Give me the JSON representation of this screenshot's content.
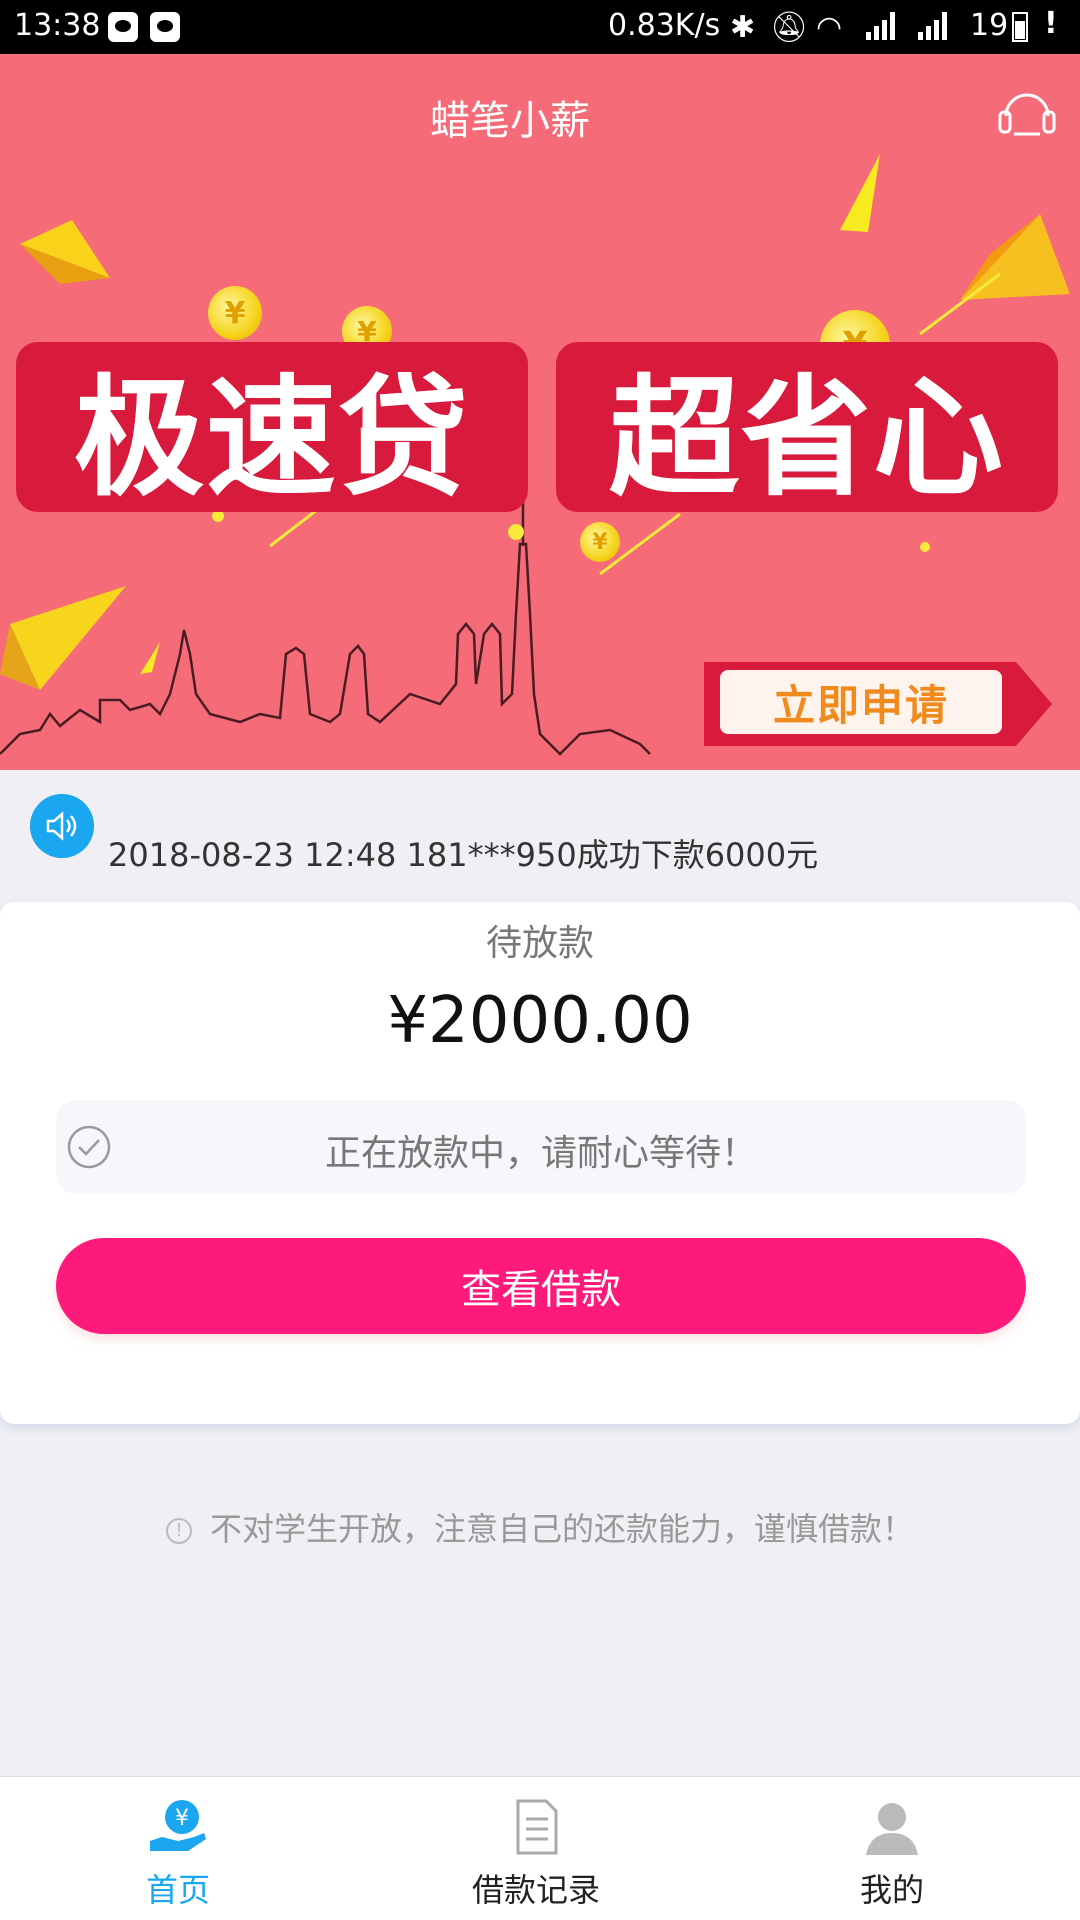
{
  "status_bar": {
    "time": "13:38",
    "speed": "0.83K/s",
    "battery": "19",
    "alert": "!"
  },
  "header": {
    "title": "蜡笔小薪"
  },
  "banner": {
    "slogan_left": "极速贷",
    "slogan_right": "超省心",
    "apply_label": "立即申请",
    "coin_symbol": "¥"
  },
  "notice": {
    "text": "2018-08-23 12:48 181***950成功下款6000元"
  },
  "loan_card": {
    "status_label": "待放款",
    "amount": "¥2000.00",
    "status_message": "正在放款中，请耐心等待！",
    "view_button": "查看借款"
  },
  "warning": {
    "text": "不对学生开放，注意自己的还款能力，谨慎借款！"
  },
  "tabs": [
    {
      "label": "首页",
      "icon": "home-yen-icon",
      "active": true
    },
    {
      "label": "借款记录",
      "icon": "document-icon",
      "active": false
    },
    {
      "label": "我的",
      "icon": "user-icon",
      "active": false
    }
  ],
  "colors": {
    "banner_bg": "#f56b78",
    "accent_pink": "#fe1a7b",
    "accent_blue": "#1aa7ef",
    "slogan_red": "#d81a3c"
  }
}
